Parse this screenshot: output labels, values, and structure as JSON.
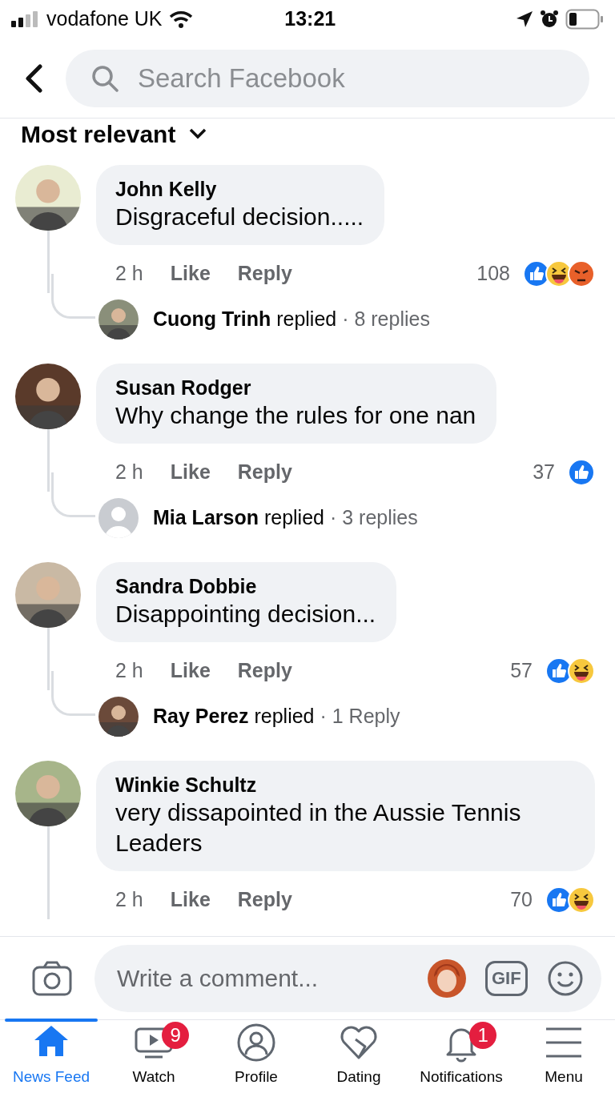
{
  "status_bar": {
    "carrier": "vodafone UK",
    "time": "13:21"
  },
  "search": {
    "placeholder": "Search Facebook"
  },
  "sort": {
    "label": "Most relevant"
  },
  "comments": [
    {
      "name": "John Kelly",
      "text": "Disgraceful decision.....",
      "time": "2 h",
      "like": "Like",
      "reply": "Reply",
      "count": "108",
      "reactions": [
        {
          "kind": "like"
        },
        {
          "kind": "haha"
        },
        {
          "kind": "angry"
        }
      ],
      "replies": {
        "kind": "photo",
        "name": "Cuong Trinh",
        "verb": "replied",
        "count": "· 8 replies"
      }
    },
    {
      "name": "Susan Rodger",
      "text": "Why change the rules for one nan",
      "time": "2 h",
      "like": "Like",
      "reply": "Reply",
      "count": "37",
      "reactions": [
        {
          "kind": "like"
        }
      ],
      "replies": {
        "kind": "default",
        "name": "Mia Larson",
        "verb": "replied",
        "count": "· 3 replies"
      }
    },
    {
      "name": "Sandra Dobbie",
      "text": "Disappointing decision...",
      "time": "2 h",
      "like": "Like",
      "reply": "Reply",
      "count": "57",
      "reactions": [
        {
          "kind": "like"
        },
        {
          "kind": "haha"
        }
      ],
      "replies": {
        "kind": "photo",
        "name": "Ray Perez",
        "verb": "replied",
        "count": "· 1 Reply"
      }
    },
    {
      "name": "Winkie Schultz",
      "text": "very dissapointed in the Aussie Tennis Leaders",
      "time": "2 h",
      "like": "Like",
      "reply": "Reply",
      "count": "70",
      "reactions": [
        {
          "kind": "like"
        },
        {
          "kind": "haha"
        }
      ]
    }
  ],
  "composer": {
    "placeholder": "Write a comment...",
    "gif": "GIF"
  },
  "tabs": [
    {
      "label": "News Feed",
      "selected": true
    },
    {
      "label": "Watch",
      "selected": false,
      "badge": "9"
    },
    {
      "label": "Profile",
      "selected": false
    },
    {
      "label": "Dating",
      "selected": false
    },
    {
      "label": "Notifications",
      "selected": false,
      "badge": "1"
    },
    {
      "label": "Menu",
      "selected": false
    }
  ]
}
